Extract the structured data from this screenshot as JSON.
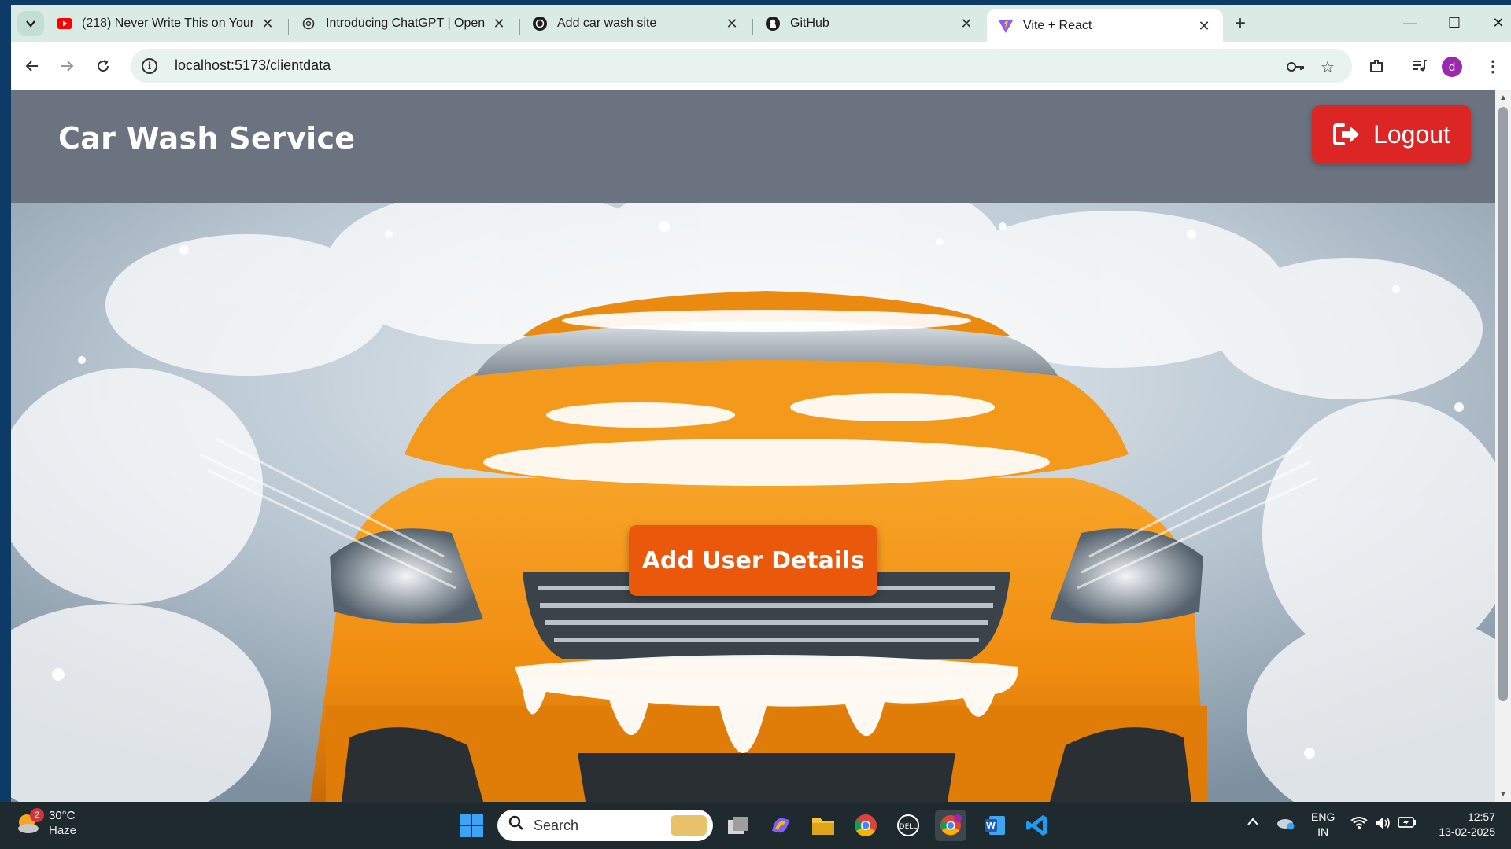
{
  "browser": {
    "tabs": [
      {
        "title": "(218) Never Write This on Your",
        "icon": "youtube-icon",
        "active": false
      },
      {
        "title": "Introducing ChatGPT | OpenAI",
        "icon": "openai-icon",
        "active": false
      },
      {
        "title": "Add car wash site",
        "icon": "openai-icon",
        "active": false
      },
      {
        "title": "GitHub",
        "icon": "github-icon",
        "active": false
      },
      {
        "title": "Vite + React",
        "icon": "vite-icon",
        "active": true
      }
    ],
    "url": "localhost:5173/clientdata",
    "profile_initial": "d"
  },
  "site": {
    "title": "Car Wash Service",
    "logout_label": "Logout",
    "add_user_label": "Add User Details",
    "colors": {
      "header": "#6b7280",
      "logout": "#dc2626",
      "add_button": "#ea580c"
    }
  },
  "taskbar": {
    "weather": {
      "temp": "30°C",
      "condition": "Haze",
      "badge": "2"
    },
    "search_placeholder": "Search",
    "lang": {
      "line1": "ENG",
      "line2": "IN"
    },
    "clock": {
      "time": "12:57",
      "date": "13-02-2025"
    },
    "apps": [
      "task-view-icon",
      "copilot-icon",
      "file-explorer-icon",
      "chrome-icon",
      "dell-icon",
      "chrome-profile-icon",
      "word-icon",
      "vscode-icon"
    ]
  }
}
